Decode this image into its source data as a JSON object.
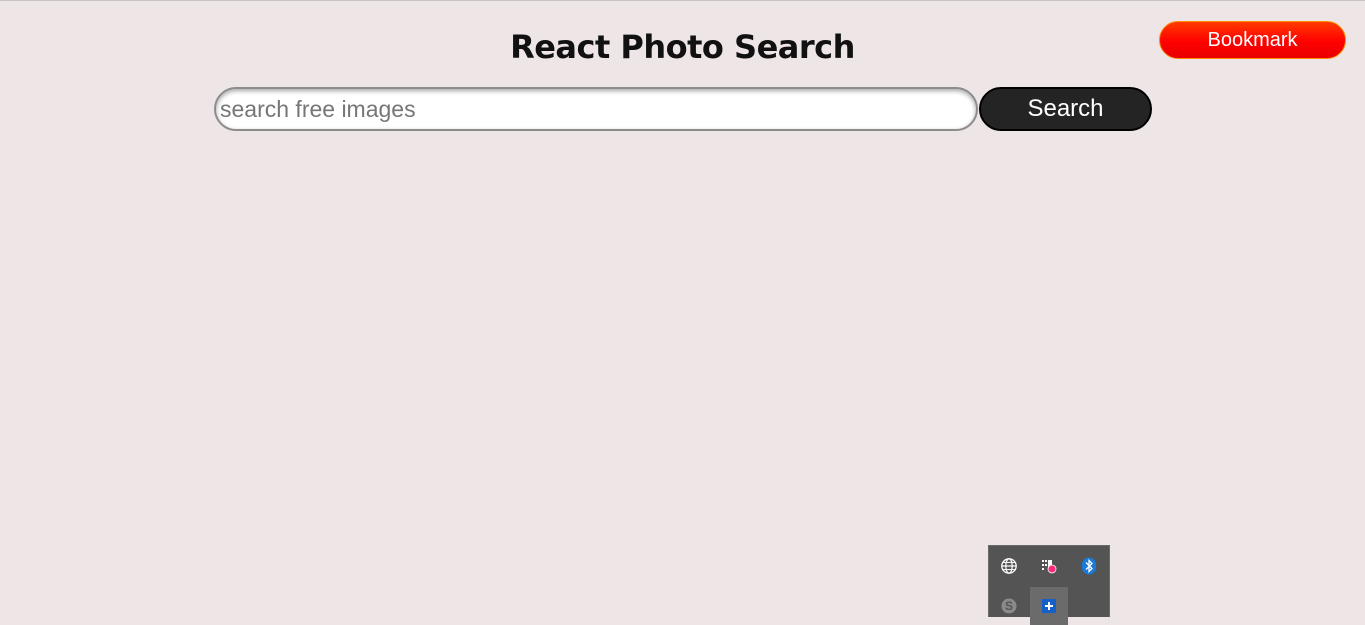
{
  "header": {
    "title": "React Photo Search"
  },
  "bookmark": {
    "label": "Bookmark"
  },
  "search": {
    "placeholder": "search free images",
    "value": "",
    "button_label": "Search"
  },
  "tray": {
    "icons": [
      {
        "name": "globe-icon"
      },
      {
        "name": "app-notification-icon"
      },
      {
        "name": "bluetooth-icon"
      },
      {
        "name": "skype-icon"
      },
      {
        "name": "plus-icon"
      }
    ]
  },
  "colors": {
    "background": "#eee5e6",
    "bookmark_red": "#ff0000",
    "search_button": "#252424"
  }
}
